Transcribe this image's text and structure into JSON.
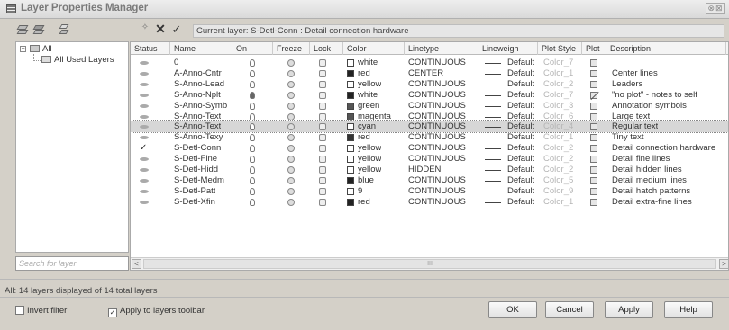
{
  "window": {
    "title": "Layer Properties Manager",
    "close_label": "⊗⊠"
  },
  "toolbar": {
    "current_layer_label": "Current layer: S-Detl-Conn : Detail connection hardware"
  },
  "filter_tree": {
    "root_label": "All",
    "child_label": "All Used Layers"
  },
  "search": {
    "placeholder": "Search for layer"
  },
  "columns": [
    "Status",
    "Name",
    "On",
    "Freeze",
    "Lock",
    "Color",
    "Linetype",
    "Lineweigh",
    "Plot Style",
    "Plot",
    "Description"
  ],
  "layers": [
    {
      "status": "inactive",
      "name": "0",
      "on": true,
      "color_name": "white",
      "color_hex": "#ffffff",
      "linetype": "CONTINUOUS",
      "lineweight": "Default",
      "plot_style": "Color_7",
      "plot": true,
      "description": ""
    },
    {
      "status": "inactive",
      "name": "A-Anno-Cntr",
      "on": true,
      "color_name": "red",
      "color_hex": "#222222",
      "linetype": "CENTER",
      "lineweight": "Default",
      "plot_style": "Color_1",
      "plot": true,
      "description": "Center lines"
    },
    {
      "status": "inactive",
      "name": "S-Anno-Lead",
      "on": true,
      "color_name": "yellow",
      "color_hex": "#ffffff",
      "linetype": "CONTINUOUS",
      "lineweight": "Default",
      "plot_style": "Color_2",
      "plot": true,
      "description": "Leaders"
    },
    {
      "status": "inactive",
      "name": "S-Anno-Nplt",
      "on": true,
      "color_name": "white",
      "color_hex": "#222222",
      "linetype": "CONTINUOUS",
      "lineweight": "Default",
      "plot_style": "Color_7",
      "plot": false,
      "description": "\"no plot\" - notes to self"
    },
    {
      "status": "inactive",
      "name": "S-Anno-Symb",
      "on": true,
      "color_name": "green",
      "color_hex": "#555555",
      "linetype": "CONTINUOUS",
      "lineweight": "Default",
      "plot_style": "Color_3",
      "plot": true,
      "description": "Annotation symbols"
    },
    {
      "status": "inactive",
      "name": "S-Anno-Text",
      "on": true,
      "color_name": "magenta",
      "color_hex": "#555555",
      "linetype": "CONTINUOUS",
      "lineweight": "Default",
      "plot_style": "Color_6",
      "plot": true,
      "description": "Large text"
    },
    {
      "status": "inactive",
      "name": "S-Anno-Text",
      "on": true,
      "color_name": "cyan",
      "color_hex": "#ffffff",
      "linetype": "CONTINUOUS",
      "lineweight": "Default",
      "plot_style": "Color_4",
      "plot": true,
      "description": "Regular text",
      "selected": true
    },
    {
      "status": "inactive",
      "name": "S-Anno-Texy",
      "on": true,
      "color_name": "red",
      "color_hex": "#333333",
      "linetype": "CONTINUOUS",
      "lineweight": "Default",
      "plot_style": "Color_1",
      "plot": true,
      "description": "Tiny text"
    },
    {
      "status": "current",
      "name": "S-Detl-Conn",
      "on": true,
      "color_name": "yellow",
      "color_hex": "#ffffff",
      "linetype": "CONTINUOUS",
      "lineweight": "Default",
      "plot_style": "Color_2",
      "plot": true,
      "description": "Detail connection hardware"
    },
    {
      "status": "inactive",
      "name": "S-Detl-Fine",
      "on": true,
      "color_name": "yellow",
      "color_hex": "#ffffff",
      "linetype": "CONTINUOUS",
      "lineweight": "Default",
      "plot_style": "Color_2",
      "plot": true,
      "description": "Detail fine lines"
    },
    {
      "status": "inactive",
      "name": "S-Detl-Hidd",
      "on": true,
      "color_name": "yellow",
      "color_hex": "#ffffff",
      "linetype": "HIDDEN",
      "lineweight": "Default",
      "plot_style": "Color_2",
      "plot": true,
      "description": "Detail hidden lines"
    },
    {
      "status": "inactive",
      "name": "S-Detl-Medm",
      "on": true,
      "color_name": "blue",
      "color_hex": "#222222",
      "linetype": "CONTINUOUS",
      "lineweight": "Default",
      "plot_style": "Color_5",
      "plot": true,
      "description": "Detail medium lines"
    },
    {
      "status": "inactive",
      "name": "S-Detl-Patt",
      "on": true,
      "color_name": "9",
      "color_hex": "#ffffff",
      "linetype": "CONTINUOUS",
      "lineweight": "Default",
      "plot_style": "Color_9",
      "plot": true,
      "description": "Detail hatch patterns"
    },
    {
      "status": "inactive",
      "name": "S-Detl-Xfin",
      "on": true,
      "color_name": "red",
      "color_hex": "#222222",
      "linetype": "CONTINUOUS",
      "lineweight": "Default",
      "plot_style": "Color_1",
      "plot": true,
      "description": "Detail extra-fine lines"
    }
  ],
  "scrollbar": {
    "left_arrow": "<",
    "right_arrow": ">",
    "thumb_label": "III"
  },
  "status_text": "All: 14 layers displayed of 14 total layers",
  "options": {
    "invert_filter_label": "Invert filter",
    "invert_filter_checked": false,
    "apply_toolbar_label": "Apply to layers toolbar",
    "apply_toolbar_checked": true
  },
  "buttons": {
    "ok": "OK",
    "cancel": "Cancel",
    "apply": "Apply",
    "help": "Help"
  }
}
